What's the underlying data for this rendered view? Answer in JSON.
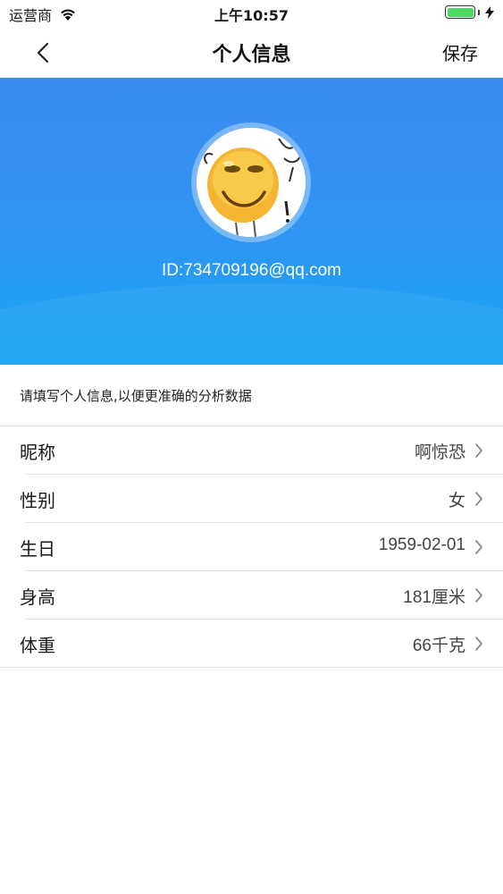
{
  "status_bar": {
    "carrier": "运营商",
    "time": "上午10:57"
  },
  "nav": {
    "title": "个人信息",
    "save_label": "保存"
  },
  "profile": {
    "id_text": "ID:734709196@qq.com"
  },
  "hint": "请填写个人信息,以便更准确的分析数据",
  "fields": [
    {
      "label": "昵称",
      "value": "啊惊恐"
    },
    {
      "label": "性别",
      "value": "女"
    },
    {
      "label": "生日",
      "value": "1959-02-01"
    },
    {
      "label": "身高",
      "value": "181厘米"
    },
    {
      "label": "体重",
      "value": "66千克"
    }
  ],
  "colors": {
    "header_top": "#3a8cf0",
    "header_bottom": "#16a6f4",
    "battery": "#4cd964"
  }
}
